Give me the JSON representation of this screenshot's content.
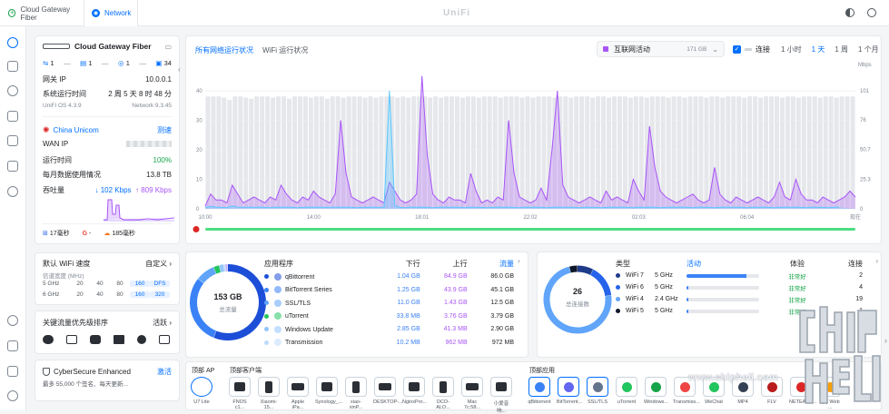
{
  "tabs": [
    {
      "label": "Cloud Gateway Fiber"
    },
    {
      "label": "Network"
    }
  ],
  "brand": "UniFi",
  "device": {
    "name": "Cloud Gateway Fiber",
    "ports": [
      "1",
      "1",
      "1",
      "34"
    ],
    "rows": [
      {
        "label": "网关 IP",
        "value": "10.0.0.1"
      },
      {
        "label": "系统运行时间",
        "value": "2 周 5 天 8 时 48 分"
      }
    ],
    "unifi_os": "UniFi OS 4.3.9",
    "network_ver": "Network 9.3.45"
  },
  "isp": {
    "name": "China Unicom",
    "speedtest": "测速",
    "rows": [
      {
        "label": "WAN IP",
        "value": ""
      },
      {
        "label": "运行时间",
        "value": "100%"
      },
      {
        "label": "每月数据使用情况",
        "value": "13.8 TB"
      }
    ],
    "throughput_label": "吞吐量",
    "down": "↓ 102 Kbps",
    "up": "↑ 809 Kbps",
    "latency": [
      "17毫秒",
      "-",
      "185毫秒"
    ]
  },
  "wifi": {
    "title": "默认 WiFi 速度",
    "custom": "自定义",
    "subtitle": "信道宽度 (MHz)",
    "rows": [
      {
        "band": "5 GHz",
        "opts": [
          "20",
          "40",
          "80",
          "160",
          "DFS"
        ]
      },
      {
        "band": "6 GHz",
        "opts": [
          "20",
          "40",
          "80",
          "160",
          "320"
        ]
      }
    ]
  },
  "priority": {
    "title": "关键流量优先级排序",
    "action": "活跃"
  },
  "cyber": {
    "title": "CyberSecure Enhanced",
    "action": "激活",
    "desc": "最多 55,000 个签名、每天更新..."
  },
  "chart_header": {
    "tab_active": "所有网络运行状况",
    "tab_other": "WiFi 运行状况",
    "select_label": "互联网活动",
    "select_value": "171 GB",
    "checkbox_label": "连接",
    "ranges": [
      "1 小时",
      "1 天",
      "1 周",
      "1 个月"
    ],
    "active_range": "1 天"
  },
  "chart_data": {
    "type": "area",
    "title": "",
    "xlabel": "",
    "ylabel_left": "",
    "ylabel_right": "Mbps",
    "x_ticks": [
      "10:00",
      "14:00",
      "18:01",
      "22:02",
      "02:03",
      "06:04",
      "现在"
    ],
    "yleft_ticks": [
      "0",
      "10",
      "20",
      "30",
      "40"
    ],
    "yright_ticks": [
      "0",
      "25.3",
      "50.7",
      "76",
      "101"
    ],
    "ylim_left": [
      0,
      48
    ],
    "ylim_right": [
      0,
      121
    ],
    "series": [
      {
        "name": "",
        "color": "#a855f7",
        "values": [
          1,
          5,
          3,
          3,
          2,
          8,
          5,
          2,
          3,
          4,
          3,
          2,
          4,
          3,
          8,
          5,
          3,
          2,
          4,
          3,
          6,
          4,
          3,
          2,
          5,
          30,
          12,
          4,
          3,
          2,
          3,
          4,
          3,
          2,
          9,
          6,
          3,
          2,
          3,
          5,
          45,
          18,
          5,
          3,
          2,
          4,
          3,
          3,
          2,
          12,
          6,
          2,
          3,
          2,
          4,
          3,
          30,
          12,
          4,
          3,
          2,
          3,
          7,
          3,
          20,
          40,
          8,
          4,
          3,
          2,
          3,
          4,
          3,
          2,
          6,
          3,
          4,
          3,
          2,
          10,
          6,
          3,
          28,
          14,
          6,
          4,
          3,
          2,
          3,
          4,
          5,
          3,
          2,
          3,
          14,
          5,
          3,
          2,
          4,
          3,
          2,
          3,
          4,
          3,
          2,
          4,
          9,
          4,
          3,
          10,
          5,
          3,
          3,
          2,
          4,
          3,
          2,
          3,
          4,
          6,
          4
        ]
      },
      {
        "name": "",
        "color": "#5cc8ff",
        "values": [
          0.5,
          0.8,
          0.6,
          0.5,
          0.4,
          1,
          0.6,
          0.5,
          0.6,
          0.5,
          0.6,
          0.5,
          0.4,
          0.6,
          0.5,
          0.6,
          0.5,
          0.4,
          0.5,
          0.6,
          0.5,
          0.6,
          0.5,
          0.5,
          0.6,
          0.5,
          0.6,
          0.5,
          0.4,
          0.5,
          0.5,
          0.6,
          0.5,
          0.4,
          40,
          1,
          0.5,
          0.4,
          0.6,
          0.5,
          0.6,
          0.5,
          0.4,
          0.5,
          0.6,
          0.5,
          0.6,
          0.5,
          0.4,
          0.6,
          0.5,
          0.5,
          0.4,
          0.5,
          0.6,
          0.5,
          0.6,
          0.5,
          0.4,
          0.6,
          0.5,
          0.6,
          0.5,
          0.4,
          0.5,
          0.6,
          0.5,
          0.6,
          0.5,
          0.4,
          0.6,
          0.5,
          0.5,
          0.4,
          0.5,
          0.6,
          0.5,
          0.6,
          0.5,
          0.4,
          0.6,
          0.5,
          0.6,
          0.5,
          0.4,
          0.5,
          0.6,
          0.5,
          0.6,
          0.5,
          0.4,
          0.6,
          0.5,
          0.5,
          0.4,
          0.5,
          0.6,
          0.5,
          0.6,
          0.5,
          0.4,
          0.6,
          0.5,
          0.6,
          0.5,
          0.4,
          0.5,
          0.6,
          0.5,
          0.6,
          0.5,
          0.4,
          0.6,
          0.5,
          0.5,
          0.4,
          0.5,
          0.6
        ]
      }
    ],
    "bars_right": [
      96,
      96,
      96,
      95,
      93,
      96,
      96,
      95,
      94,
      96,
      96,
      96,
      95,
      96,
      96,
      94,
      96,
      96,
      96,
      95,
      96,
      96,
      94,
      96,
      96,
      95,
      96,
      96,
      96,
      95,
      96,
      95,
      96,
      96,
      96,
      95,
      96,
      95,
      96,
      96,
      96,
      95,
      96,
      95,
      96,
      96,
      96,
      95,
      96,
      96,
      95,
      96,
      96,
      96,
      95,
      96,
      96,
      96,
      95,
      96,
      95,
      96,
      96,
      96,
      95,
      96,
      96,
      95,
      96,
      96,
      96,
      95,
      96,
      96,
      95,
      96,
      96,
      96,
      95,
      96,
      96,
      95,
      96,
      96,
      96,
      95,
      96,
      96,
      95,
      96,
      96,
      96,
      95,
      96,
      96,
      95,
      96,
      96,
      96,
      95,
      96,
      96,
      95,
      96,
      96,
      96,
      95,
      96,
      96,
      95,
      96,
      96,
      96,
      95,
      96,
      96,
      95,
      96,
      96,
      96
    ]
  },
  "traffic": {
    "total": "153 GB",
    "total_label": "总流量",
    "headers": [
      "应用程序",
      "下行",
      "上行",
      "流量"
    ],
    "apps": [
      {
        "name": "qBittorrent",
        "down": "1.04 GB",
        "up": "84.9 GB",
        "total": "86.0 GB",
        "color": "#1d4ed8"
      },
      {
        "name": "BitTorrent Series",
        "down": "1.25 GB",
        "up": "43.9 GB",
        "total": "45.1 GB",
        "color": "#3b82f6"
      },
      {
        "name": "SSL/TLS",
        "down": "11.0 GB",
        "up": "1.43 GB",
        "total": "12.5 GB",
        "color": "#60a5fa"
      },
      {
        "name": "uTorrent",
        "down": "33.8 MB",
        "up": "3.76 GB",
        "total": "3.79 GB",
        "color": "#22c55e"
      },
      {
        "name": "Windows Update",
        "down": "2.85 GB",
        "up": "41.3 MB",
        "total": "2.90 GB",
        "color": "#93c5fd"
      },
      {
        "name": "Transmission",
        "down": "10.2 MB",
        "up": "962 MB",
        "total": "972 MB",
        "color": "#bfdbfe"
      }
    ],
    "donut": [
      86.0,
      45.1,
      12.5,
      3.79,
      2.9,
      0.97,
      1.7
    ]
  },
  "clients": {
    "total": "26",
    "total_label": "总连接数",
    "headers": [
      "类型",
      "活动",
      "体验",
      "连接"
    ],
    "rows": [
      {
        "type": "WiFi 7",
        "band": "5 GHz",
        "activity": 0.82,
        "exp": "非常好",
        "count": "2"
      },
      {
        "type": "WiFi 6",
        "band": "5 GHz",
        "activity": 0.03,
        "exp": "非常好",
        "count": "4"
      },
      {
        "type": "WiFi 4",
        "band": "2.4 GHz",
        "activity": 0.03,
        "exp": "非常好",
        "count": "19"
      },
      {
        "type": "WiFi 5",
        "band": "5 GHz",
        "activity": 0.02,
        "exp": "非常好",
        "count": "1"
      }
    ],
    "donut": [
      2,
      4,
      19,
      1
    ]
  },
  "bottom": {
    "top_ap": "顶部 AP",
    "top_clients": "顶部客户端",
    "top_apps": "顶部应用",
    "ap_name": "U7 Lite",
    "clients": [
      "FNOS c1...",
      "Xiaomi-15...",
      "Apple iPa...",
      "Synology_...",
      "xiao-xinP...",
      "DESKTOP-...",
      "NginxPro...",
      "DCO-ALO...",
      "Mac 7c:58...",
      "小爱音响..."
    ],
    "apps": [
      "qBittorrent",
      "BitTorrent...",
      "SSL/TLS",
      "uTorrent",
      "Windows...",
      "Transmiss...",
      "WeChat",
      "MP4",
      "FLV",
      "NETEASE...",
      "QQ Web ..."
    ]
  },
  "watermark": "www.chiphell.com"
}
